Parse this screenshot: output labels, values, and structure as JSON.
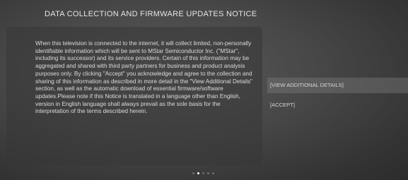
{
  "notice": {
    "title": "DATA COLLECTION AND FIRMWARE UPDATES NOTICE",
    "body": "When this television is connected to the internet, it will collect limited, non-personally identifiable information which will be sent to MStar Semiconductor Inc. (\"MStar\", including its successor) and its service providers. Certain of this information may be aggregated and shared with third party partners for business and product analysis purposes only. By clicking \"Accept\" you acknowledge and agree to the collection and sharing of this information as described in more detail in the \"View Additional Details\" section, as well as the automatic download of essential firmware/software updates.Please note if this Notice is translated in a language other than English, version in English language shall always prevail as the sole basis for the interpretation of the terms described herein."
  },
  "actions": {
    "view_details_label": "[VIEW ADDITIONAL DETAILS]",
    "accept_label": "[ACCEPT]"
  },
  "pager": {
    "total": 5,
    "active_index": 1
  },
  "colors": {
    "text": "#dcdcdc",
    "highlight": "#787878",
    "dot_active": "#ffffff",
    "dot_inactive": "#6e6e6e"
  }
}
